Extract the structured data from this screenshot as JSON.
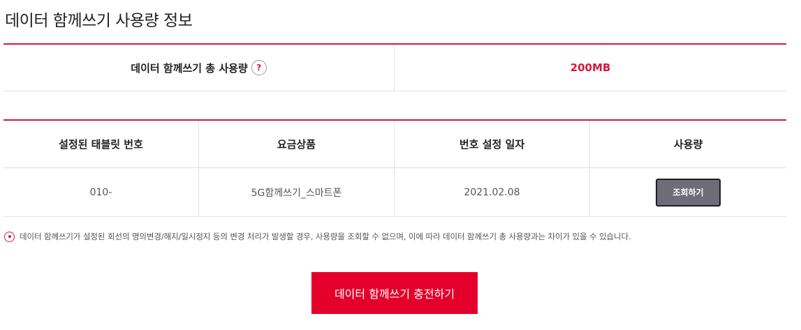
{
  "page": {
    "title": "데이터 함께쓰기 사용량 정보"
  },
  "total_usage": {
    "label": "데이터 함께쓰기 총 사용량",
    "help_icon": "?",
    "value": "200MB"
  },
  "detail_table": {
    "headers": [
      "설정된 태블릿 번호",
      "요금상품",
      "번호 설정 일자",
      "사용량"
    ],
    "rows": [
      {
        "number": "010-",
        "plan": "5G함께쓰기_스마트폰",
        "date": "2021.02.08",
        "action_label": "조회하기"
      }
    ]
  },
  "notice": {
    "icon": "info-circle-icon",
    "text": "데이터 함께쓰기가 설정된 회선의 명의변경/해지/일시정지 등의 변경 처리가 발생할 경우, 사용량을 조회할 수 없으며, 이에 따라 데이터 함께쓰기 총 사용량과는 차이가 있을 수 있습니다."
  },
  "actions": {
    "charge_label": "데이터 함께쓰기 충전하기"
  },
  "colors": {
    "accent": "#d6183a",
    "button_primary": "#e4002b",
    "button_lookup": "#6e6c77"
  }
}
